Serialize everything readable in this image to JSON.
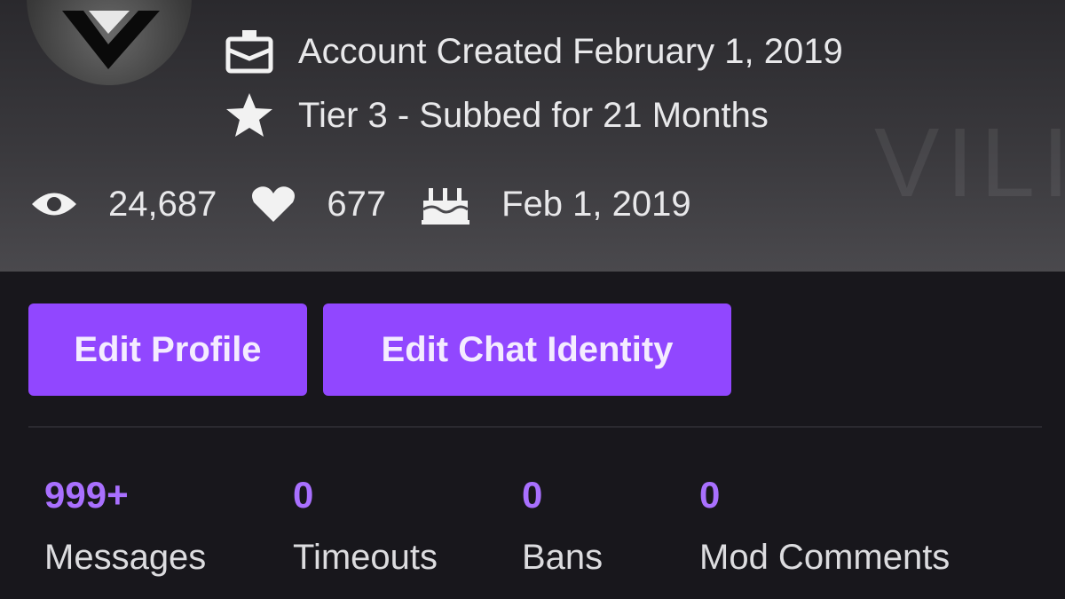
{
  "profile": {
    "account_created": "Account Created February 1, 2019",
    "subscription": "Tier 3 - Subbed for 21 Months",
    "watermark": "VILI"
  },
  "stats": {
    "views": "24,687",
    "followers": "677",
    "birthday": "Feb 1, 2019"
  },
  "actions": {
    "edit_profile": "Edit Profile",
    "edit_chat_identity": "Edit Chat Identity"
  },
  "counters": [
    {
      "value": "999+",
      "label": "Messages"
    },
    {
      "value": "0",
      "label": "Timeouts"
    },
    {
      "value": "0",
      "label": "Bans"
    },
    {
      "value": "0",
      "label": "Mod Comments"
    }
  ],
  "colors": {
    "accent": "#9147ff",
    "count_text": "#a970ff",
    "background": "#18171c"
  },
  "icons": [
    "eye-icon",
    "heart-icon",
    "cake-icon",
    "calendar-gift-icon",
    "star-icon"
  ]
}
